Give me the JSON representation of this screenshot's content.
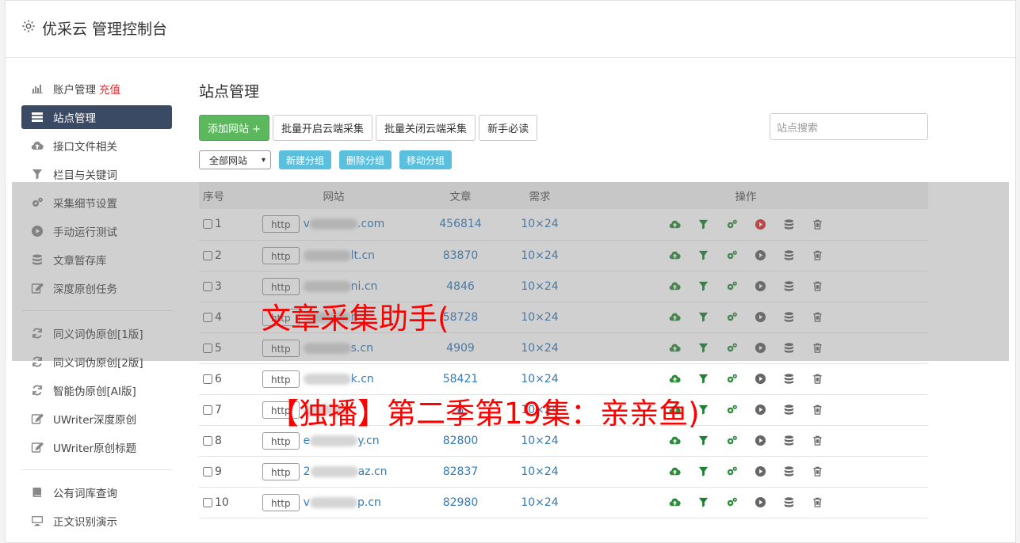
{
  "header": {
    "title": "优采云 管理控制台"
  },
  "sidebar": {
    "items": [
      {
        "label": "账户管理",
        "extra": "充值",
        "icon": "bar-chart-icon"
      },
      {
        "label": "站点管理",
        "icon": "server-icon",
        "active": true
      },
      {
        "label": "接口文件相关",
        "icon": "cloud-upload-icon"
      },
      {
        "label": "栏目与关键词",
        "icon": "filter-icon"
      },
      {
        "label": "采集细节设置",
        "icon": "gears-icon"
      },
      {
        "label": "手动运行测试",
        "icon": "play-circle-icon"
      },
      {
        "label": "文章暂存库",
        "icon": "database-icon"
      },
      {
        "label": "深度原创任务",
        "icon": "edit-icon"
      }
    ],
    "group2": [
      {
        "label": "同义词伪原创[1版]",
        "icon": "refresh-icon"
      },
      {
        "label": "同义词伪原创[2版]",
        "icon": "refresh-icon"
      },
      {
        "label": "智能伪原创[AI版]",
        "icon": "refresh-icon"
      },
      {
        "label": "UWriter深度原创",
        "icon": "edit-icon"
      },
      {
        "label": "UWriter原创标题",
        "icon": "edit-icon"
      }
    ],
    "group3": [
      {
        "label": "公有词库查询",
        "icon": "book-icon"
      },
      {
        "label": "正文识别演示",
        "icon": "monitor-icon"
      }
    ]
  },
  "main": {
    "title": "站点管理",
    "buttons": {
      "add": "添加网站 +",
      "batch_open": "批量开启云端采集",
      "batch_close": "批量关闭云端采集",
      "guide": "新手必读"
    },
    "search_placeholder": "站点搜索",
    "filter_select": "全部网站",
    "group_buttons": {
      "new": "新建分组",
      "delete": "删除分组",
      "move": "移动分组"
    },
    "table": {
      "headers": {
        "no": "序号",
        "site": "网站",
        "articles": "文章",
        "demand": "需求",
        "ops": "操作"
      },
      "rows": [
        {
          "no": "1",
          "prefix": "http",
          "domain_head": "v",
          "domain_tail": ".com",
          "articles": "456814",
          "demand": "10×24",
          "run_active": true
        },
        {
          "no": "2",
          "prefix": "http",
          "domain_head": "",
          "domain_tail": "lt.cn",
          "articles": "83870",
          "demand": "10×24"
        },
        {
          "no": "3",
          "prefix": "http",
          "domain_head": "",
          "domain_tail": "ni.cn",
          "articles": "4846",
          "demand": "10×24"
        },
        {
          "no": "4",
          "prefix": "http",
          "domain_head": "",
          "domain_tail": "n",
          "articles": "58728",
          "demand": "10×24"
        },
        {
          "no": "5",
          "prefix": "http",
          "domain_head": "",
          "domain_tail": "s.cn",
          "articles": "4909",
          "demand": "10×24"
        },
        {
          "no": "6",
          "prefix": "http",
          "domain_head": "",
          "domain_tail": "k.cn",
          "articles": "58421",
          "demand": "10×24"
        },
        {
          "no": "7",
          "prefix": "http",
          "domain_head": "",
          "domain_tail": "",
          "articles": "8",
          "demand": "10×24"
        },
        {
          "no": "8",
          "prefix": "http",
          "domain_head": "e",
          "domain_tail": "y.cn",
          "articles": "82800",
          "demand": "10×24"
        },
        {
          "no": "9",
          "prefix": "http",
          "domain_head": "2",
          "domain_tail": "az.cn",
          "articles": "82837",
          "demand": "10×24"
        },
        {
          "no": "10",
          "prefix": "http",
          "domain_head": "v",
          "domain_tail": "p.cn",
          "articles": "82980",
          "demand": "10×24"
        }
      ]
    }
  },
  "overlay": {
    "caption_line1": "文章采集助手(",
    "caption_line2": "【独播】第二季第19集：亲亲鱼)"
  },
  "colors": {
    "sidebar_active": "#3b4a64",
    "green": "#5cb85c",
    "info": "#5bc0de",
    "link": "#337ab7",
    "caption": "#ff0000"
  }
}
